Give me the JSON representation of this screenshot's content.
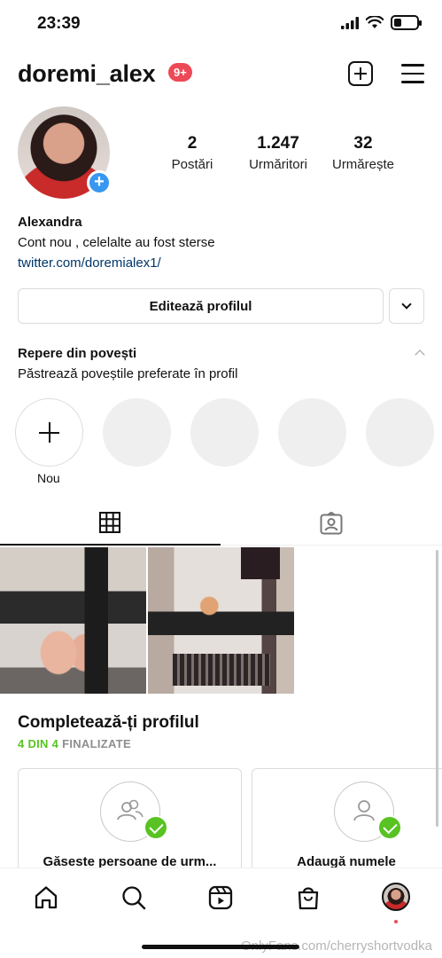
{
  "status_bar": {
    "time": "23:39",
    "battery_level": 0.35
  },
  "header": {
    "username": "doremi_alex",
    "notification_badge": "9+"
  },
  "profile": {
    "stats": [
      {
        "value": "2",
        "label": "Postări"
      },
      {
        "value": "1.247",
        "label": "Urmăritori"
      },
      {
        "value": "32",
        "label": "Urmărește"
      }
    ],
    "name": "Alexandra",
    "bio": "Cont nou , celelalte au fost sterse",
    "link": "twitter.com/doremialex1/",
    "edit_button": "Editează profilul"
  },
  "highlights": {
    "title": "Repere din povești",
    "subtitle": "Păstrează poveștile preferate în profil",
    "new_label": "Nou"
  },
  "tabs": [
    {
      "icon": "grid-icon",
      "active": true
    },
    {
      "icon": "tagged-icon",
      "active": false
    }
  ],
  "complete_profile": {
    "title": "Completează-ți profilul",
    "progress_done": "4 DIN 4",
    "progress_label": "FINALIZATE",
    "cards": [
      {
        "icon": "people-icon",
        "label": "Găseste persoane de urm..."
      },
      {
        "icon": "person-icon",
        "label": "Adaugă numele"
      }
    ]
  },
  "bottom_nav": [
    "home-icon",
    "search-icon",
    "reels-icon",
    "shop-icon",
    "profile-avatar"
  ],
  "watermark": "OnlyFans.com/cherryshortvodka",
  "colors": {
    "badge": "#ed4956",
    "link": "#00376b",
    "accent_blue": "#3897f0",
    "complete_green": "#58c322"
  }
}
